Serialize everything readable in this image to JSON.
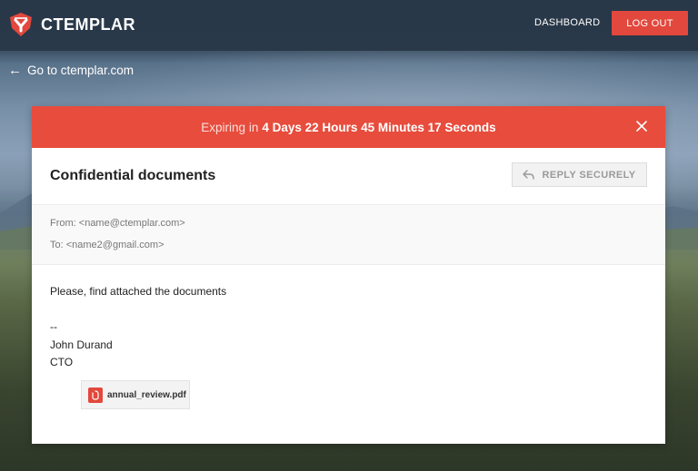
{
  "brand": {
    "name": "CTEMPLAR"
  },
  "nav": {
    "dashboard": "DASHBOARD",
    "logout": "LOG OUT"
  },
  "back_link": "Go to ctemplar.com",
  "expire": {
    "prefix": "Expiring in",
    "remaining": "4 Days 22 Hours 45 Minutes 17 Seconds"
  },
  "message": {
    "subject": "Confidential documents",
    "reply_label": "REPLY SECURELY",
    "from": "From: <name@ctemplar.com>",
    "to": "To: <name2@gmail.com>",
    "body_line": "Please, find attached the documents",
    "sig_sep": "--",
    "sig_name": "John Durand",
    "sig_title": "CTO",
    "attachment": "annual_review.pdf"
  },
  "colors": {
    "accent": "#e74c3c",
    "topbar": "#2f4256"
  },
  "icons": {
    "logo": "ctemplar-shield-icon",
    "back": "arrow-left-icon",
    "close": "close-icon",
    "reply": "reply-arrow-icon",
    "attachment": "pdf-file-icon"
  }
}
